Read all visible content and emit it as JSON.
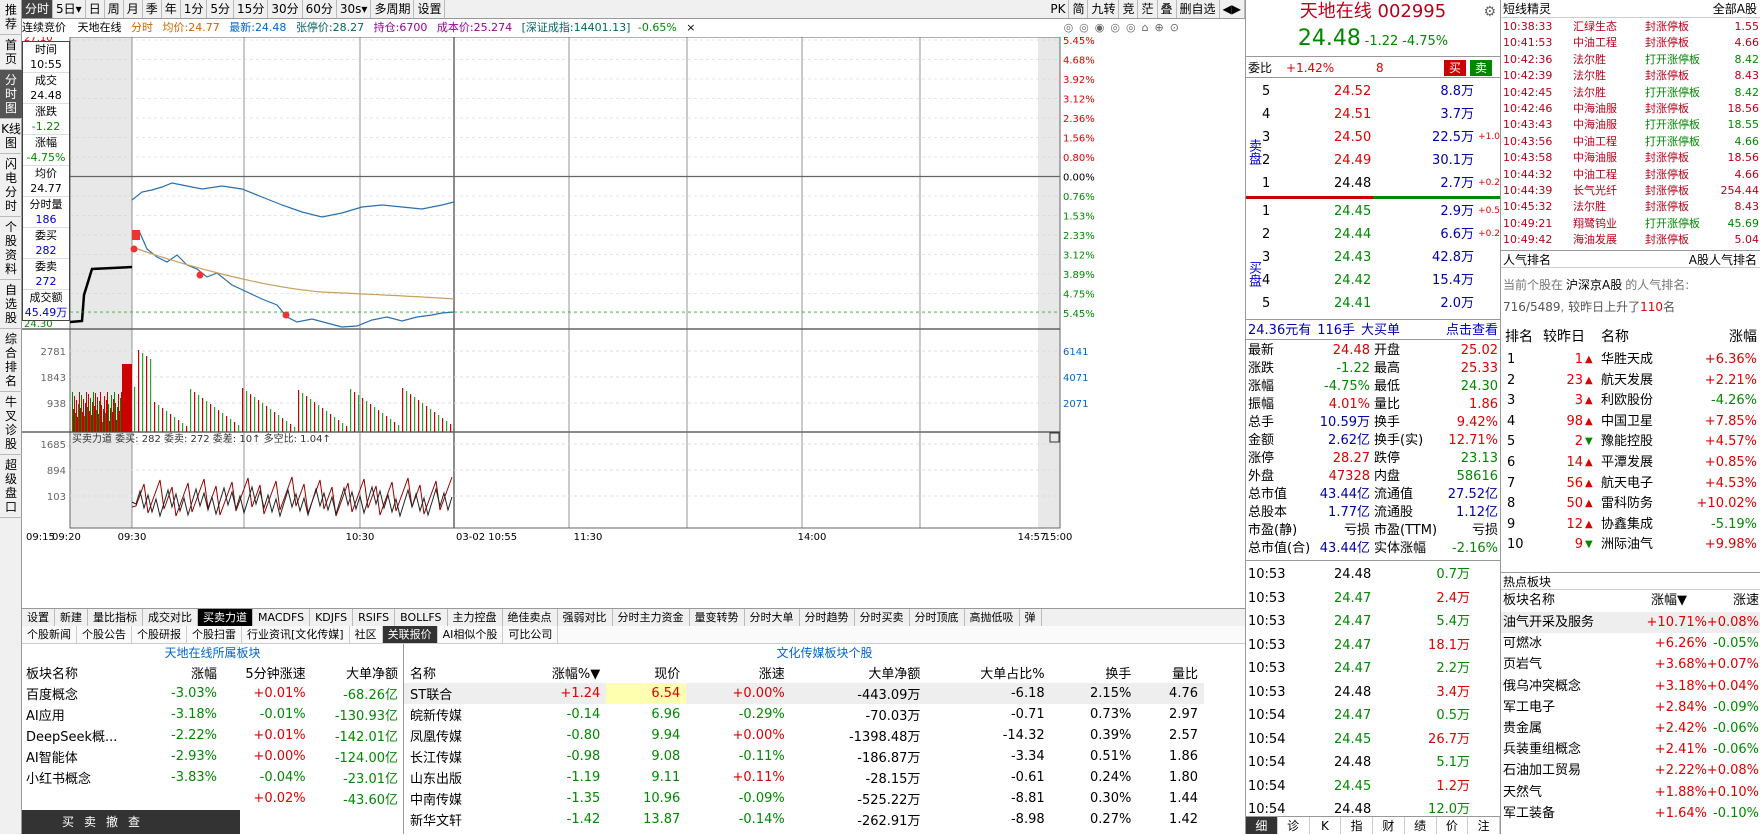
{
  "sidebar": [
    "推荐",
    "首页",
    "分时图",
    "K线图",
    "闪电分时",
    "个股资料",
    "自选股",
    "综合排名",
    "牛叉诊股",
    "超级盘口"
  ],
  "toolbar": {
    "left": [
      "分时",
      "5日▾",
      "日",
      "周",
      "月",
      "季",
      "年",
      "1分",
      "5分",
      "15分",
      "30分",
      "60分",
      "30s▾",
      "多周期",
      "设置"
    ],
    "right": [
      "PK",
      "简",
      "九转",
      "竞",
      "茫",
      "叠",
      "删自选",
      "◀▶"
    ]
  },
  "chart_header": {
    "auction": "连续竞价",
    "name": "天地在线",
    "mode": "分时",
    "avg_label": "均价:",
    "avg": "24.77",
    "last_label": "最新:",
    "last": "24.48",
    "limit_label": "张停价:",
    "limit": "28.27",
    "hold_label": "持仓:",
    "hold": "6700",
    "cost_label": "成本价:",
    "cost": "25.274",
    "index_label": "[深证成指:",
    "index": "14401.13]",
    "index_chg": "-0.65%"
  },
  "price_axis_left": [
    "27.10",
    "24.30"
  ],
  "pct_axis": [
    "5.45%",
    "4.68%",
    "3.92%",
    "3.12%",
    "2.36%",
    "1.56%",
    "0.80%",
    "0.00%",
    "0.76%",
    "1.53%",
    "2.33%",
    "3.12%",
    "3.89%",
    "4.75%",
    "5.45%"
  ],
  "vol_axis_left": [
    "2781",
    "1843",
    "938"
  ],
  "vol_axis_right": [
    "6141",
    "4071",
    "2071"
  ],
  "lower_axis_left": [
    "1685",
    "894",
    "103"
  ],
  "time_axis": [
    "09:15",
    "09:20",
    "09:30",
    "10:30",
    "03-02 10:55",
    "11:30",
    "14:00",
    "14:57",
    "15:00"
  ],
  "hover_box": [
    [
      "时间",
      "10:55"
    ],
    [
      "成交",
      "24.48"
    ],
    [
      "涨跌",
      "-1.22"
    ],
    [
      "涨幅",
      "-4.75%"
    ],
    [
      "均价",
      "24.77"
    ],
    [
      "分时量",
      "186"
    ],
    [
      "委买",
      "282"
    ],
    [
      "委卖",
      "272"
    ],
    [
      "成交额",
      "45.49万"
    ]
  ],
  "lower_header": "买卖力道 委买: 282  委卖: 272  委差: 10↑ 多空比: 1.04↑",
  "bottom_tabs": [
    "设置",
    "新建",
    "量比指标",
    "成交对比",
    "买卖力道",
    "MACDFS",
    "KDJFS",
    "RSIFS",
    "BOLLFS",
    "主力控盘",
    "绝佳卖点",
    "强弱对比",
    "分时主力资金",
    "量变转势",
    "分时大单",
    "分时趋势",
    "分时买卖",
    "分时顶底",
    "高抛低吸",
    "弹"
  ],
  "sub_tabs": [
    "个股新闻",
    "个股公告",
    "个股研报",
    "个股扫雷",
    "行业资讯[文化传媒]",
    "社区",
    "关联报价",
    "AI相似个股",
    "可比公司"
  ],
  "block_panel": {
    "title": "天地在线所属板块",
    "headers": [
      "板块名称",
      "涨幅",
      "5分钟涨速",
      "大单净额"
    ],
    "rows": [
      [
        "百度概念",
        "-3.03%",
        "+0.01%",
        "-68.26亿"
      ],
      [
        "AI应用",
        "-3.18%",
        "-0.01%",
        "-130.93亿"
      ],
      [
        "DeepSeek概...",
        "-2.22%",
        "+0.01%",
        "-142.01亿"
      ],
      [
        "AI智能体",
        "-2.93%",
        "+0.00%",
        "-124.00亿"
      ],
      [
        "小红书概念",
        "-3.83%",
        "-0.04%",
        "-23.01亿"
      ],
      [
        "",
        "",
        "+0.02%",
        "-43.60亿"
      ]
    ],
    "bottom_icons": [
      "买",
      "卖",
      "撤",
      "查"
    ]
  },
  "stock_panel": {
    "title": "文化传媒板块个股",
    "headers": [
      "名称",
      "涨幅%▼",
      "现价",
      "涨速",
      "大单净额",
      "大单占比%",
      "换手",
      "量比"
    ],
    "rows": [
      [
        "ST联合",
        "+1.24",
        "6.54",
        "+0.00%",
        "-443.09万",
        "-6.18",
        "2.15%",
        "4.76"
      ],
      [
        "皖新传媒",
        "-0.14",
        "6.96",
        "-0.29%",
        "-70.03万",
        "-0.71",
        "0.73%",
        "2.97"
      ],
      [
        "凤凰传媒",
        "-0.80",
        "9.94",
        "+0.00%",
        "-1398.48万",
        "-14.32",
        "0.39%",
        "2.57"
      ],
      [
        "长江传媒",
        "-0.98",
        "9.08",
        "-0.11%",
        "-186.87万",
        "-3.34",
        "0.51%",
        "1.86"
      ],
      [
        "山东出版",
        "-1.19",
        "9.11",
        "+0.11%",
        "-28.15万",
        "-0.61",
        "0.24%",
        "1.80"
      ],
      [
        "中南传媒",
        "-1.35",
        "10.96",
        "-0.09%",
        "-525.22万",
        "-8.81",
        "0.30%",
        "1.44"
      ],
      [
        "新华文轩",
        "-1.42",
        "13.87",
        "-0.14%",
        "-262.91万",
        "-8.98",
        "0.27%",
        "1.42"
      ]
    ]
  },
  "quote": {
    "name": "天地在线",
    "code": "002995",
    "price": "24.48",
    "chg": "-1.22",
    "pct": "-4.75%",
    "weibi_label": "委比",
    "weibi": "+1.42%",
    "weicha": "8",
    "buy_btn": "买",
    "sell_btn": "卖",
    "sell": [
      [
        "5",
        "24.52",
        "8.8万",
        ""
      ],
      [
        "4",
        "24.51",
        "3.7万",
        ""
      ],
      [
        "3",
        "24.50",
        "22.5万",
        "+1.0"
      ],
      [
        "2",
        "24.49",
        "30.1万",
        ""
      ],
      [
        "1",
        "24.48",
        "2.7万",
        "+0.2"
      ]
    ],
    "buy": [
      [
        "1",
        "24.45",
        "2.9万",
        "+0.5"
      ],
      [
        "2",
        "24.44",
        "6.6万",
        "+0.2"
      ],
      [
        "3",
        "24.43",
        "42.8万",
        ""
      ],
      [
        "4",
        "24.42",
        "15.4万",
        ""
      ],
      [
        "5",
        "24.41",
        "2.0万",
        ""
      ]
    ],
    "sell_label": "卖盘",
    "buy_label": "买盘",
    "bigorder": [
      "24.36元有",
      "116手",
      "大买单",
      "点击查看"
    ],
    "stats": [
      [
        "最新",
        "24.48",
        "开盘",
        "25.02"
      ],
      [
        "涨跌",
        "-1.22",
        "最高",
        "25.33"
      ],
      [
        "涨幅",
        "-4.75%",
        "最低",
        "24.30"
      ],
      [
        "振幅",
        "4.01%",
        "量比",
        "1.86"
      ],
      [
        "总手",
        "10.59万",
        "换手",
        "9.42%"
      ],
      [
        "金额",
        "2.62亿",
        "换手(实)",
        "12.71%"
      ],
      [
        "涨停",
        "28.27",
        "跌停",
        "23.13"
      ],
      [
        "外盘",
        "47328",
        "内盘",
        "58616"
      ],
      [
        "总市值",
        "43.44亿",
        "流通值",
        "27.52亿"
      ],
      [
        "总股本",
        "1.77亿",
        "流通股",
        "1.12亿"
      ],
      [
        "市盈(静)",
        "亏损",
        "市盈(TTM)",
        "亏损"
      ],
      [
        "总市值(合)",
        "43.44亿",
        "实体涨幅",
        "-2.16%"
      ]
    ],
    "ticks": [
      [
        "10:53",
        "24.48",
        "0.7万"
      ],
      [
        "10:53",
        "24.47",
        "2.4万"
      ],
      [
        "10:53",
        "24.47",
        "5.4万"
      ],
      [
        "10:53",
        "24.47",
        "18.1万"
      ],
      [
        "10:53",
        "24.47",
        "2.2万"
      ],
      [
        "10:53",
        "24.48",
        "3.4万"
      ],
      [
        "10:54",
        "24.47",
        "0.5万"
      ],
      [
        "10:54",
        "24.45",
        "26.7万"
      ],
      [
        "10:54",
        "24.48",
        "5.1万"
      ],
      [
        "10:54",
        "24.45",
        "1.2万"
      ],
      [
        "10:54",
        "24.48",
        "12.0万"
      ]
    ],
    "bottom_tabs": [
      "细",
      "诊",
      "K",
      "指",
      "财",
      "绩",
      "价",
      "注"
    ]
  },
  "short_elves": {
    "title": "短线精灵",
    "filter": "全部A股",
    "rows": [
      [
        "10:38:33",
        "汇绿生态",
        "封涨停板",
        "1.55"
      ],
      [
        "10:41:53",
        "中油工程",
        "封涨停板",
        "4.66"
      ],
      [
        "10:42:36",
        "法尔胜",
        "打开涨停板",
        "8.42"
      ],
      [
        "10:42:39",
        "法尔胜",
        "封涨停板",
        "8.43"
      ],
      [
        "10:42:45",
        "法尔胜",
        "打开涨停板",
        "8.42"
      ],
      [
        "10:42:46",
        "中海油服",
        "封涨停板",
        "18.56"
      ],
      [
        "10:43:43",
        "中海油服",
        "打开涨停板",
        "18.55"
      ],
      [
        "10:43:56",
        "中油工程",
        "打开涨停板",
        "4.66"
      ],
      [
        "10:43:58",
        "中海油服",
        "封涨停板",
        "18.56"
      ],
      [
        "10:44:32",
        "中油工程",
        "封涨停板",
        "4.66"
      ],
      [
        "10:44:39",
        "长气光纤",
        "封涨停板",
        "254.44"
      ],
      [
        "10:45:32",
        "法尔胜",
        "封涨停板",
        "8.43"
      ],
      [
        "10:49:21",
        "翔鹭钨业",
        "打开涨停板",
        "45.69"
      ],
      [
        "10:49:42",
        "海油发展",
        "封涨停板",
        "5.04"
      ]
    ]
  },
  "popularity": {
    "title": "人气排名",
    "filter": "A股人气排名",
    "desc1": "当前个股在",
    "desc_market": "沪深京A股",
    "desc2": "的人气排名:",
    "rank": "716/5489",
    "rise_text": "较昨日上升了",
    "rise": "110",
    "unit": "名",
    "headers": [
      "排名",
      "较昨日",
      "名称",
      "涨幅"
    ],
    "rows": [
      [
        "1",
        "1",
        "华胜天成",
        "+6.36%"
      ],
      [
        "2",
        "23",
        "航天发展",
        "+2.21%"
      ],
      [
        "3",
        "3",
        "利欧股份",
        "-4.26%"
      ],
      [
        "4",
        "98",
        "中国卫星",
        "+7.85%"
      ],
      [
        "5",
        "2",
        "豫能控股",
        "+4.57%"
      ],
      [
        "6",
        "14",
        "平潭发展",
        "+0.85%"
      ],
      [
        "7",
        "56",
        "航天电子",
        "+4.53%"
      ],
      [
        "8",
        "50",
        "雷科防务",
        "+10.02%"
      ],
      [
        "9",
        "12",
        "协鑫集成",
        "-5.19%"
      ],
      [
        "10",
        "9",
        "洲际油气",
        "+9.98%"
      ]
    ],
    "dirs": [
      "up",
      "up",
      "up",
      "up",
      "dn",
      "up",
      "up",
      "up",
      "up",
      "dn"
    ]
  },
  "hot_blocks": {
    "title": "热点板块",
    "headers": [
      "板块名称",
      "涨幅▼",
      "涨速"
    ],
    "rows": [
      [
        "油气开采及服务",
        "+10.71%",
        "+0.08%"
      ],
      [
        "可燃冰",
        "+6.26%",
        "-0.05%"
      ],
      [
        "页岩气",
        "+3.68%",
        "+0.07%"
      ],
      [
        "俄乌冲突概念",
        "+3.18%",
        "+0.04%"
      ],
      [
        "军工电子",
        "+2.84%",
        "-0.09%"
      ],
      [
        "贵金属",
        "+2.42%",
        "-0.06%"
      ],
      [
        "兵装重组概念",
        "+2.41%",
        "-0.06%"
      ],
      [
        "石油加工贸易",
        "+2.22%",
        "+0.08%"
      ],
      [
        "天然气",
        "+1.88%",
        "+0.10%"
      ],
      [
        "军工装备",
        "+1.64%",
        "-0.10%"
      ]
    ]
  },
  "colors": {
    "up": "#d00000",
    "down": "#008000",
    "price_line": "#2a6fb0",
    "avg_line": "#c8a060",
    "accent_red": "#b8001a"
  }
}
